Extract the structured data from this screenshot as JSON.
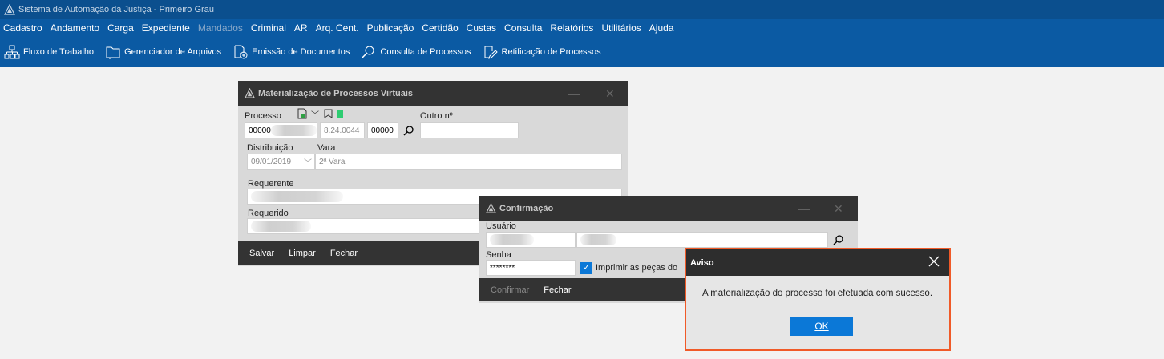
{
  "app": {
    "title": "Sistema de Automação da Justiça - Primeiro Grau"
  },
  "menu": [
    {
      "label": "Cadastro",
      "disabled": false
    },
    {
      "label": "Andamento",
      "disabled": false
    },
    {
      "label": "Carga",
      "disabled": false
    },
    {
      "label": "Expediente",
      "disabled": false
    },
    {
      "label": "Mandados",
      "disabled": true
    },
    {
      "label": "Criminal",
      "disabled": false
    },
    {
      "label": "AR",
      "disabled": false
    },
    {
      "label": "Arq. Cent.",
      "disabled": false
    },
    {
      "label": "Publicação",
      "disabled": false
    },
    {
      "label": "Certidão",
      "disabled": false
    },
    {
      "label": "Custas",
      "disabled": false
    },
    {
      "label": "Consulta",
      "disabled": false
    },
    {
      "label": "Relatórios",
      "disabled": false
    },
    {
      "label": "Utilitários",
      "disabled": false
    },
    {
      "label": "Ajuda",
      "disabled": false
    }
  ],
  "toolbar": [
    {
      "label": "Fluxo de Trabalho",
      "icon": "workflow-icon"
    },
    {
      "label": "Gerenciador de Arquivos",
      "icon": "file-manager-icon"
    },
    {
      "label": "Emissão de Documentos",
      "icon": "document-add-icon"
    },
    {
      "label": "Consulta de Processos",
      "icon": "search-process-icon"
    },
    {
      "label": "Retificação de Processos",
      "icon": "edit-process-icon"
    }
  ],
  "materializacao": {
    "title": "Materialização de Processos Virtuais",
    "processo_label": "Processo",
    "processo_part1": "00000",
    "processo_part2": "8.24.0044",
    "processo_part3": "00000",
    "outro_label": "Outro nº",
    "outro_value": "",
    "distribuicao_label": "Distribuição",
    "distribuicao_value": "09/01/2019",
    "vara_label": "Vara",
    "vara_value": "2ª Vara",
    "requerente_label": "Requerente",
    "requerido_label": "Requerido",
    "buttons": {
      "salvar": "Salvar",
      "limpar": "Limpar",
      "fechar": "Fechar"
    }
  },
  "confirmacao": {
    "title": "Confirmação",
    "usuario_label": "Usuário",
    "senha_label": "Senha",
    "senha_value": "********",
    "imprimir_label": "Imprimir as peças do",
    "imprimir_checked": true,
    "buttons": {
      "confirmar": "Confirmar",
      "fechar": "Fechar"
    }
  },
  "aviso": {
    "title": "Aviso",
    "message": "A materialização do processo foi efetuada com sucesso.",
    "ok_label": "OK"
  },
  "colors": {
    "accent": "#0b78d7",
    "menubar": "#0b5aa3",
    "highlight_border": "#f05a28",
    "status_green": "#2ecc71"
  }
}
